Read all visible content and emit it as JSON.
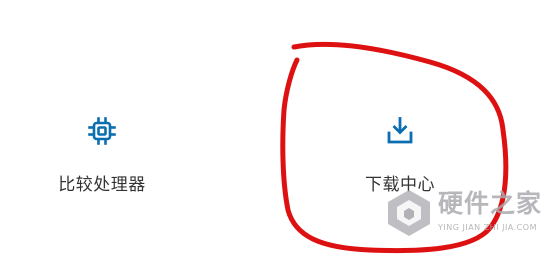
{
  "tiles": {
    "compare_processors": {
      "label": "比较处理器",
      "icon": "processor-chip-icon"
    },
    "download_center": {
      "label": "下载中心",
      "icon": "download-tray-icon"
    }
  },
  "colors": {
    "icon_accent": "#0b6eb0",
    "label_text": "#333333",
    "annotation_stroke": "#dd1111",
    "watermark": "#aaaaaf"
  },
  "annotation": {
    "shape": "hand-drawn-circle-around-download-center"
  },
  "watermark": {
    "logo": "hardware-home-logo",
    "title": "硬件之家",
    "subtitle": "YING JIAN ZHI JIA.COM"
  }
}
